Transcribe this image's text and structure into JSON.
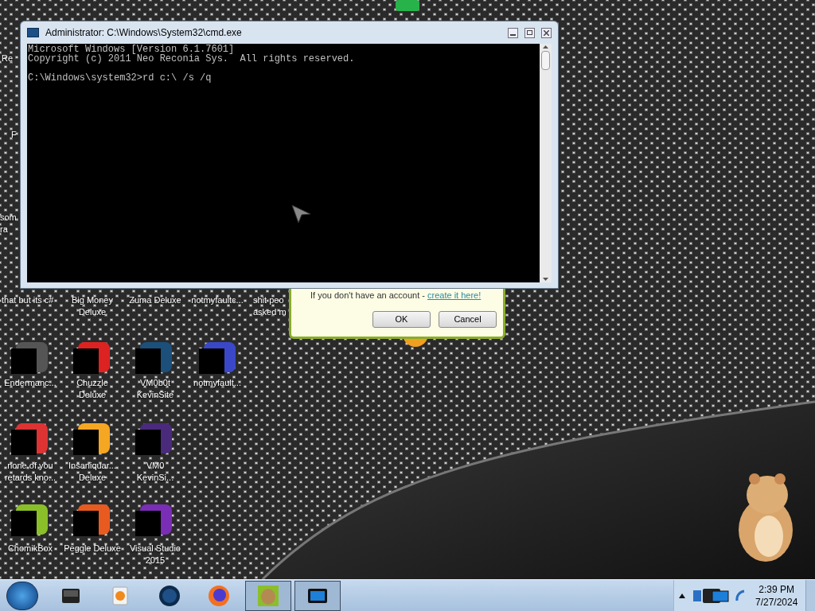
{
  "desktop_icons": [
    {
      "label_lines": [
        "Re"
      ]
    },
    {
      "label_lines": [
        "F"
      ]
    },
    {
      "label_lines": [
        "som",
        "ra"
      ]
    },
    {
      "label_lines": [
        "that but its c#"
      ]
    },
    {
      "label_lines": [
        "Big Money",
        "Deluxe"
      ]
    },
    {
      "label_lines": [
        "Zuma Deluxe"
      ]
    },
    {
      "label_lines": [
        "notmyfaultc..."
      ]
    },
    {
      "label_lines": [
        "shit peo",
        "asked m"
      ]
    },
    {
      "label_lines": [
        "Endermanc..."
      ]
    },
    {
      "label_lines": [
        "Chuzzle",
        "Deluxe"
      ]
    },
    {
      "label_lines": [
        "VM0b0t",
        "KevinSite"
      ]
    },
    {
      "label_lines": [
        "notmyfault..."
      ]
    },
    {
      "label_lines": [
        "none of you",
        "retards kno..."
      ]
    },
    {
      "label_lines": [
        "Insaniquar...",
        "Deluxe"
      ]
    },
    {
      "label_lines": [
        "VM0",
        "KevinSi..."
      ]
    },
    {
      "label_lines": [
        "ChomikBox"
      ]
    },
    {
      "label_lines": [
        "Peggle Deluxe"
      ]
    },
    {
      "label_lines": [
        "Visual Studio",
        "2015"
      ]
    }
  ],
  "dialog": {
    "text": "If you don't have an account - ",
    "link": "create it here!",
    "buttons": [
      "OK",
      "Cancel"
    ]
  },
  "cmd_window": {
    "title": "Administrator: C:\\Windows\\System32\\cmd.exe",
    "header_lines": [
      "Microsoft Windows [Version 6.1.7601]",
      "Copyright (c) 2011 Neo Reconia Sys.  All rights reserved."
    ],
    "prompt": "C:\\Windows\\system32>rd c:\\ /s /q"
  },
  "taskbar": {
    "apps": [
      {
        "running": false
      },
      {
        "running": false
      },
      {
        "running": false
      },
      {
        "running": false
      },
      {
        "running": true
      },
      {
        "running": true
      }
    ],
    "clock": {
      "time": "2:39 PM",
      "date": "7/27/2024"
    }
  }
}
